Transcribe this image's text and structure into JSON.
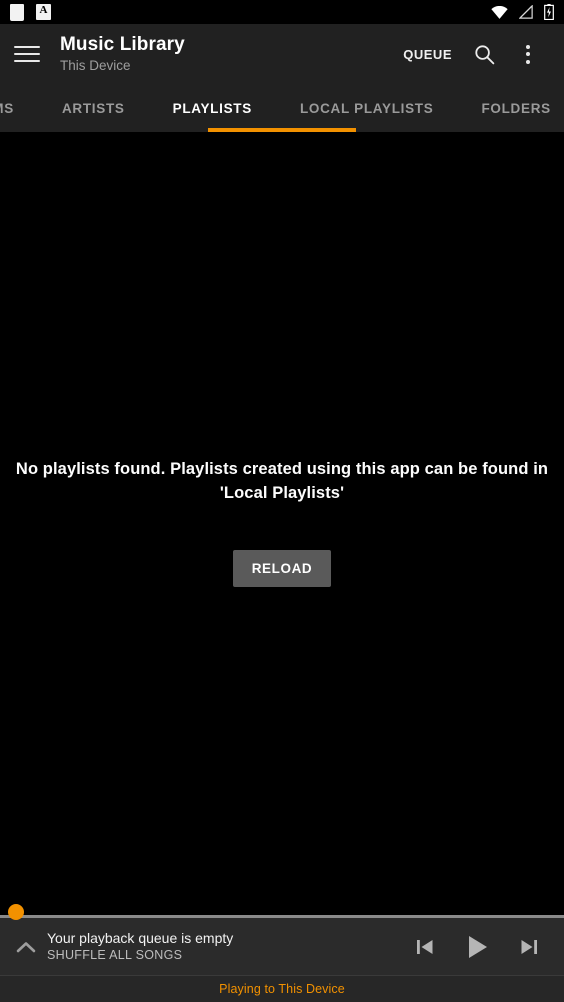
{
  "colors": {
    "accent": "#f29100",
    "appbar_bg": "#212121",
    "content_bg": "#000000",
    "player_bg": "#2b2b2b",
    "footer_bg": "#272727",
    "button_bg": "#5a5a5a"
  },
  "statusbar": {
    "left_icons": [
      {
        "name": "note-icon",
        "glyph": ""
      },
      {
        "name": "keyboard-language-icon",
        "glyph": "A"
      }
    ],
    "right_icons": [
      {
        "name": "wifi-icon"
      },
      {
        "name": "no-signal-icon"
      },
      {
        "name": "battery-charging-icon"
      }
    ]
  },
  "appbar": {
    "menu_icon": "hamburger-menu-icon",
    "title": "Music Library",
    "subtitle": "This Device",
    "queue_label": "QUEUE",
    "search_icon": "search-icon",
    "overflow_icon": "more-vertical-icon"
  },
  "tabs": {
    "items": [
      {
        "label": "ALBUMS",
        "active": false
      },
      {
        "label": "ARTISTS",
        "active": false
      },
      {
        "label": "PLAYLISTS",
        "active": true
      },
      {
        "label": "LOCAL PLAYLISTS",
        "active": false
      },
      {
        "label": "FOLDERS",
        "active": false
      }
    ],
    "active_label": "PLAYLISTS"
  },
  "content": {
    "empty_message": "No playlists found. Playlists created using this app can be found in 'Local Playlists'",
    "reload_label": "RELOAD"
  },
  "player": {
    "progress_percent": 0,
    "expand_icon": "chevron-up-icon",
    "queue_status": "Your playback queue is empty",
    "shuffle_label": "SHUFFLE ALL SONGS",
    "controls": [
      {
        "name": "previous-button",
        "icon": "skip-previous-icon"
      },
      {
        "name": "play-button",
        "icon": "play-icon"
      },
      {
        "name": "next-button",
        "icon": "skip-next-icon"
      }
    ]
  },
  "footer": {
    "casting_text": "Playing to This Device"
  }
}
